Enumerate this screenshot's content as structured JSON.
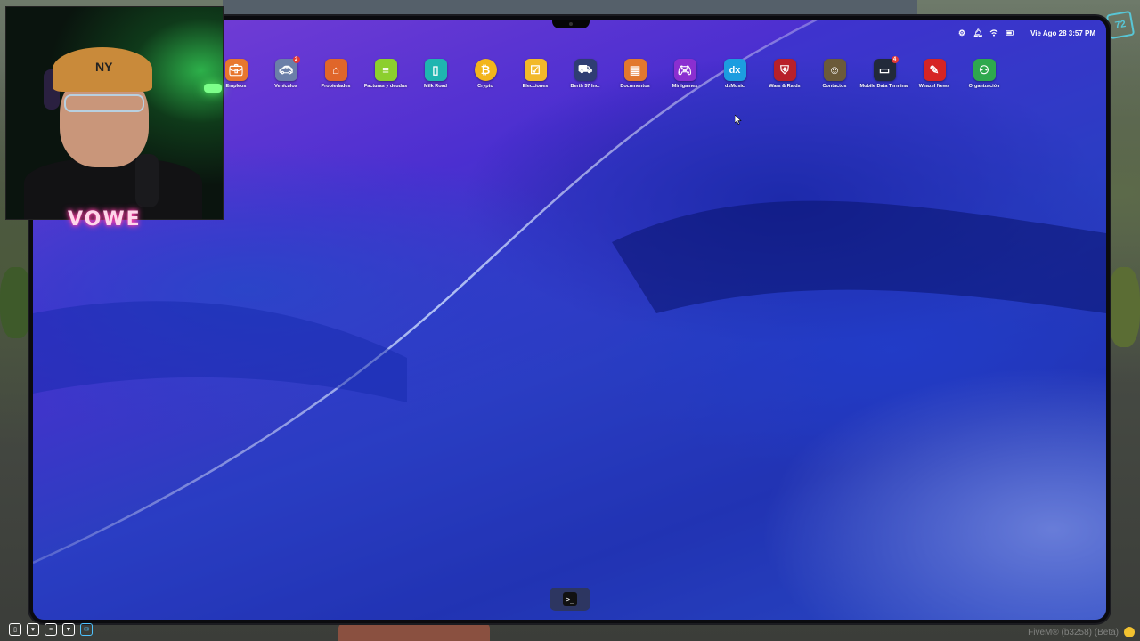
{
  "status_bar": {
    "datetime": "Vie Ago 28 3:57 PM",
    "icons": [
      "gear-icon",
      "bell-icon",
      "wifi-icon",
      "battery-icon"
    ]
  },
  "apps": [
    {
      "id": "empleos",
      "label": "Empleos",
      "icon": "briefcase-icon",
      "color": "#e8772e",
      "badge": ""
    },
    {
      "id": "vehiculos",
      "label": "Vehículos",
      "icon": "car-icon",
      "color": "#6b7fa8",
      "badge": "2"
    },
    {
      "id": "propiedades",
      "label": "Propiedades",
      "icon": "house-icon",
      "color": "#e0662a",
      "badge": ""
    },
    {
      "id": "facturas",
      "label": "Facturas y deudas",
      "icon": "invoice-icon",
      "color": "#8ccf2e",
      "badge": ""
    },
    {
      "id": "milkroad",
      "label": "Milk Road",
      "icon": "milk-icon",
      "color": "#1fb5b0",
      "badge": ""
    },
    {
      "id": "crypto",
      "label": "Crypto",
      "icon": "coin-icon",
      "color": "#f3b51c",
      "badge": ""
    },
    {
      "id": "elecciones",
      "label": "Elecciones",
      "icon": "ballot-icon",
      "color": "#f2b92a",
      "badge": ""
    },
    {
      "id": "berth",
      "label": "Berth 57 Inc.",
      "icon": "truck-icon",
      "color": "#2f3d73",
      "badge": ""
    },
    {
      "id": "documentos",
      "label": "Documentos",
      "icon": "document-icon",
      "color": "#e2782e",
      "badge": ""
    },
    {
      "id": "minigames",
      "label": "Minigames",
      "icon": "gamepad-icon",
      "color": "#8b2fd0",
      "badge": ""
    },
    {
      "id": "dxmusic",
      "label": "dxMusic",
      "icon": "dx-icon",
      "color": "#1c9de0",
      "badge": ""
    },
    {
      "id": "wars",
      "label": "Wars & Raids",
      "icon": "shield-icon",
      "color": "#b8202a",
      "badge": ""
    },
    {
      "id": "contactos",
      "label": "Contactos",
      "icon": "contacts-icon",
      "color": "#6b5a3a",
      "badge": ""
    },
    {
      "id": "mdt",
      "label": "Mobile Data Terminal",
      "icon": "monitor-icon",
      "color": "#222a3a",
      "badge": "4"
    },
    {
      "id": "weazel",
      "label": "Weazel News",
      "icon": "news-icon",
      "color": "#d62424",
      "badge": ""
    },
    {
      "id": "organizacion",
      "label": "Organización",
      "icon": "organization-icon",
      "color": "#2ea84e",
      "badge": ""
    }
  ],
  "dock": {
    "apps": [
      {
        "label": ">_",
        "icon": "terminal-icon"
      }
    ]
  },
  "webcam": {
    "brand": "VOWE"
  },
  "hud": {
    "fivem_text": "FiveM® (b3258) (Beta)",
    "icons": [
      "phone-icon",
      "heart-icon",
      "menu-icon",
      "shirt-icon",
      "mail-icon"
    ]
  }
}
